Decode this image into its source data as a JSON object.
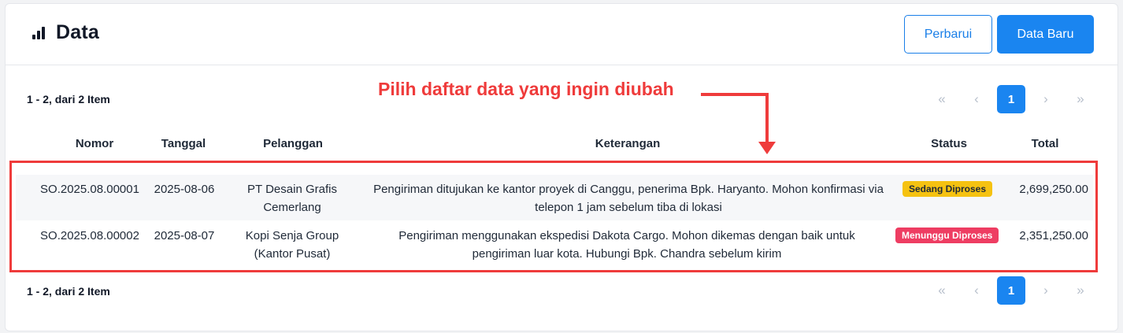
{
  "header": {
    "title": "Data",
    "refresh_label": "Perbarui",
    "new_label": "Data Baru"
  },
  "summary": {
    "top": "1 - 2, dari 2 Item",
    "bottom": "1 - 2, dari 2 Item"
  },
  "annotation": "Pilih daftar data yang ingin diubah",
  "pagination": {
    "first": "«",
    "prev": "‹",
    "current": "1",
    "next": "›",
    "last": "»"
  },
  "table": {
    "columns": [
      "Nomor",
      "Tanggal",
      "Pelanggan",
      "Keterangan",
      "Status",
      "Total"
    ],
    "rows": [
      {
        "nomor": "SO.2025.08.00001",
        "tanggal": "2025-08-06",
        "pelanggan": "PT Desain Grafis Cemerlang",
        "keterangan": "Pengiriman ditujukan ke kantor proyek di Canggu, penerima Bpk. Haryanto. Mohon konfirmasi via telepon 1 jam sebelum tiba di lokasi",
        "status": "Sedang Diproses",
        "total": "2,699,250.00"
      },
      {
        "nomor": "SO.2025.08.00002",
        "tanggal": "2025-08-07",
        "pelanggan": "Kopi Senja Group (Kantor Pusat)",
        "keterangan": "Pengiriman menggunakan ekspedisi Dakota Cargo. Mohon dikemas dengan baik untuk pengiriman luar kota. Hubungi Bpk. Chandra sebelum kirim",
        "status": "Menunggu Diproses",
        "total": "2,351,250.00"
      }
    ]
  },
  "colors": {
    "primary": "#1a85f0",
    "annotation": "#ef3b3b",
    "status_processing": "#f5c211",
    "status_waiting": "#ee3d62"
  }
}
